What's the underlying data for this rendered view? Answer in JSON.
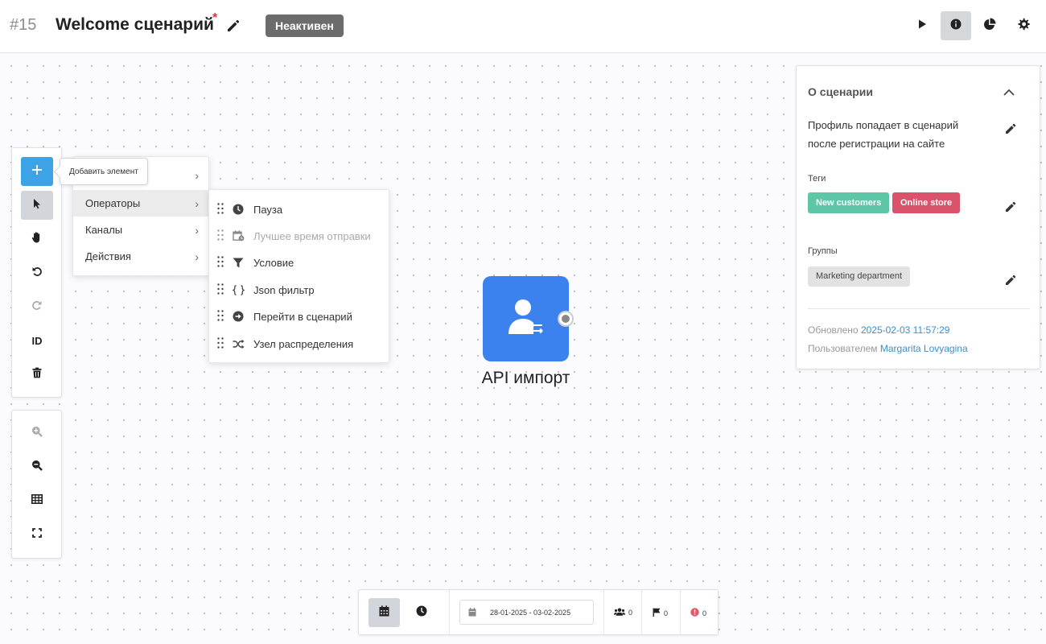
{
  "header": {
    "number": "#15",
    "title": "Welcome сценарий",
    "unsaved_mark": "*",
    "status": "Неактивен"
  },
  "toolbar": {
    "id_label": "ID",
    "add_tooltip": "Добавить элемент"
  },
  "menu": {
    "items": [
      {
        "label": ""
      },
      {
        "label": "Операторы"
      },
      {
        "label": "Каналы"
      },
      {
        "label": "Действия"
      }
    ],
    "chevron": "›"
  },
  "submenu": {
    "items": [
      {
        "label": "Пауза",
        "icon": "clock-icon"
      },
      {
        "label": "Лучшее время отправки",
        "icon": "calendar-clock-icon"
      },
      {
        "label": "Условие",
        "icon": "filter-icon"
      },
      {
        "label": "Json фильтр",
        "icon": "braces-icon"
      },
      {
        "label": "Перейти в сценарий",
        "icon": "arrow-circle-icon"
      },
      {
        "label": "Узел распределения",
        "icon": "shuffle-icon"
      }
    ]
  },
  "node": {
    "label": "API импорт",
    "icon": "user-transfer-icon"
  },
  "panel": {
    "title": "О сценарии",
    "description": "Профиль попадает в сценарий после регистрации на сайте",
    "tags_label": "Теги",
    "tags": [
      {
        "label": "New customers",
        "color": "#5cc6a6"
      },
      {
        "label": "Online store",
        "color": "#d9536a"
      }
    ],
    "groups_label": "Группы",
    "groups": [
      {
        "label": "Marketing department"
      }
    ],
    "updated_label": "Обновлено",
    "updated_value": "2025-02-03 11:57:29",
    "user_label": "Пользователем",
    "user_value": "Margarita Lovyagina"
  },
  "bottom": {
    "date_range": "28-01-2025 - 03-02-2025",
    "profiles_count": "0",
    "goals_count": "0",
    "errors_count": "0"
  },
  "colors": {
    "accent": "#3ba3e6",
    "node": "#3b82ee",
    "status_inactive": "#6c6c6c",
    "link": "#3a8fcd"
  }
}
